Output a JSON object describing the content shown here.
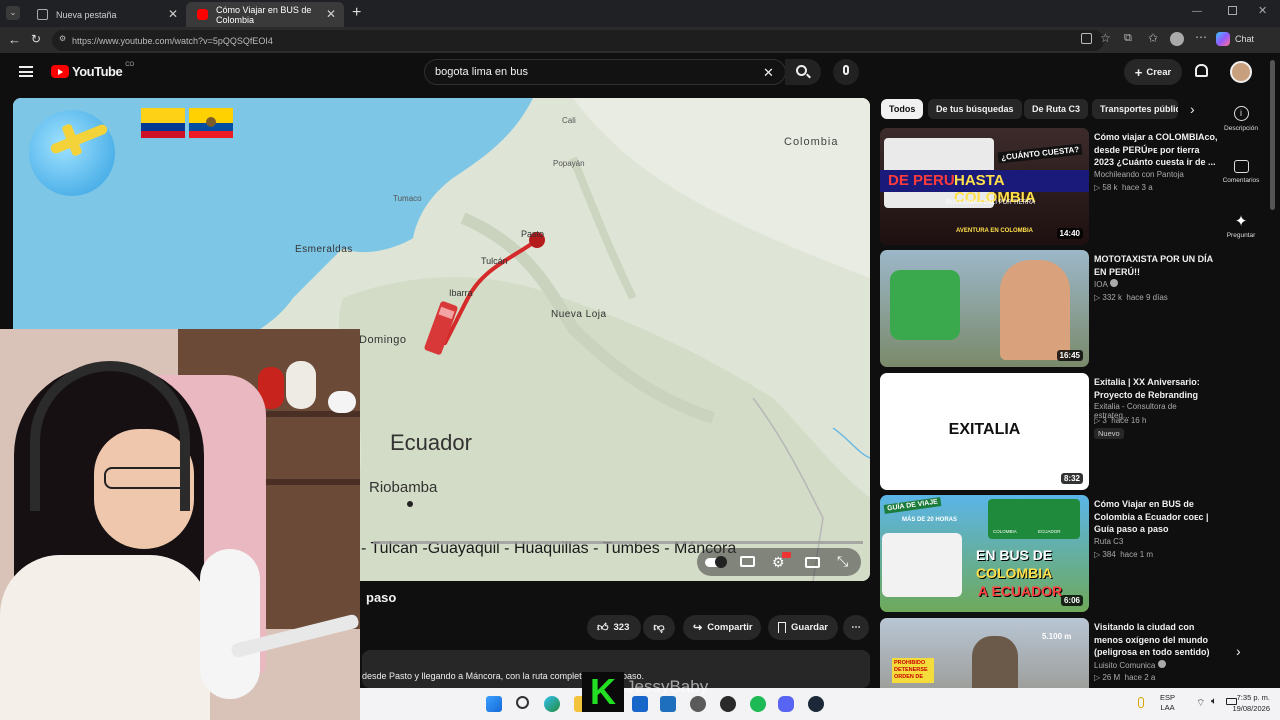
{
  "browser": {
    "tabs": [
      {
        "label": "Nueva pestaña"
      },
      {
        "label": "Cómo Viajar en BUS de Colombia"
      }
    ],
    "url": "https://www.youtube.com/watch?v=5pQQSQfEOI4",
    "chat_label": "Chat"
  },
  "youtube": {
    "logo_text": "YouTube",
    "region": "CO",
    "search_value": "bogota lima en bus",
    "create_label": "Crear"
  },
  "video": {
    "map_labels": {
      "country_top": "Colombia",
      "cali": "Cali",
      "popayan": "Popayán",
      "tumaco": "Tumaco",
      "esmeraldas": "Esmeraldas",
      "pasto": "Pasto",
      "tulcan": "Tulcán",
      "ibarra": "Ibarra",
      "nueva_loja": "Nueva Loja",
      "domingo": "Domingo",
      "ecuador": "Ecuador",
      "riobamba": "Riobamba"
    },
    "route_caption": "- Tulcan -Guayaquil - Huaquillas - Tumbes - Máncora",
    "title_fragment": "paso",
    "likes": "323",
    "share_label": "Compartir",
    "save_label": "Guardar",
    "description_fragment": "desde Pasto y llegando a Máncora, con la ruta complet",
    "description_end": "paso."
  },
  "chips": [
    "Todos",
    "De tus búsquedas",
    "De Ruta C3",
    "Transportes públic"
  ],
  "recommendations": [
    {
      "title": "Cómo viajar a COLOMBIAᴄᴏ, desde PERÚᴘᴇ por tierra 2023 ¿Cuánto cuesta ir de ...",
      "channel": "Mochileando con Pantoja",
      "views": "58 k",
      "age": "hace 3 a",
      "duration": "14:40",
      "thumb_top": "¿CUÁNTO CUESTA?",
      "thumb_main_a": "DE PERU",
      "thumb_main_b": "HASTA COLOMBIA",
      "thumb_sub": "RUTA LIMA A CALI POR TIERRA",
      "thumb_badge": "AVENTURA EN COLOMBIA"
    },
    {
      "title": "MOTOTAXISTA POR UN DÍA EN PERÚ!!",
      "channel": "IOA",
      "views": "332 k",
      "age": "hace 9 días",
      "duration": "16:45"
    },
    {
      "title": "Exitalia | XX Aniversario: Proyecto de Rebranding",
      "channel": "Exitalia - Consultora de estrateg...",
      "views": "3",
      "age": "hace 16 h",
      "badge": "Nuevo",
      "duration": "8:32",
      "thumb_text": "EXITALIA"
    },
    {
      "title": "Cómo Viajar en BUS de Colombia a Ecuador ᴄᴏᴇᴄ | Guía paso a paso",
      "channel": "Ruta C3",
      "views": "384",
      "age": "hace 1 m",
      "duration": "6:06",
      "thumb_guide": "GUÍA DE VIAJE",
      "thumb_hours": "MÁS DE 20 HORAS",
      "thumb_co": "COLOMBIA",
      "thumb_ec": "ECUADOR",
      "thumb_main_a": "EN BUS DE",
      "thumb_main_b": "COLOMBIA",
      "thumb_main_c": "A ECUADOR"
    },
    {
      "title": "Visitando la ciudad con menos oxígeno del mundo (peligrosa en todo sentido)...",
      "channel": "Luisito Comunica",
      "views": "26 M",
      "age": "hace 2 a",
      "thumb_alt": "5.100 m",
      "thumb_sign": "PROHIBIDO DETENERSE ORDEN DE"
    }
  ],
  "rail": [
    "Descripción",
    "Comentarios",
    "Preguntar"
  ],
  "overlay": {
    "streamer_tag": "JessyBaby",
    "k_logo": "K"
  },
  "taskbar": {
    "lang_a": "ESP",
    "lang_b": "LAA",
    "time": "7:35 p. m.",
    "date": "19/08/2026"
  }
}
